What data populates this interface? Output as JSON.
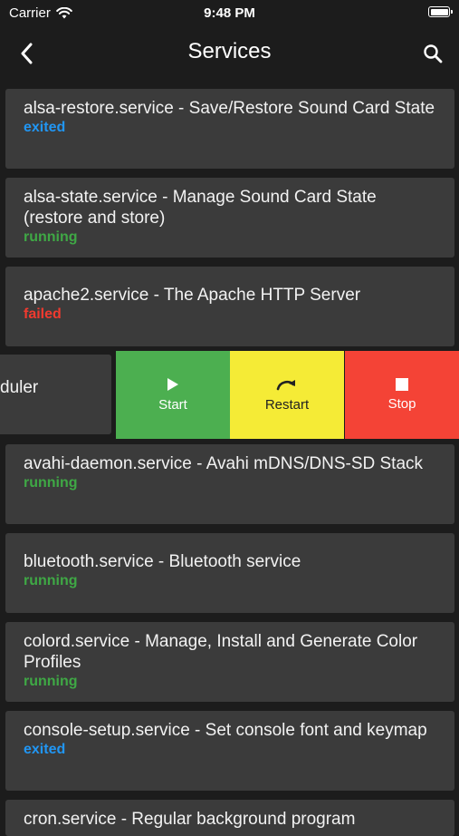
{
  "status_bar": {
    "carrier": "Carrier",
    "time": "9:48 PM"
  },
  "nav": {
    "title": "Services"
  },
  "services": [
    {
      "title": "alsa-restore.service - Save/Restore Sound Card State",
      "status": "exited"
    },
    {
      "title": "alsa-state.service - Manage Sound Card State (restore and store)",
      "status": "running"
    },
    {
      "title": "apache2.service - The Apache HTTP Server",
      "status": "failed"
    },
    {
      "title": "duler"
    },
    {
      "title": "avahi-daemon.service - Avahi mDNS/DNS-SD Stack",
      "status": "running"
    },
    {
      "title": "bluetooth.service - Bluetooth service",
      "status": "running"
    },
    {
      "title": "colord.service - Manage, Install and Generate Color Profiles",
      "status": "running"
    },
    {
      "title": "console-setup.service - Set console font and keymap",
      "status": "exited"
    },
    {
      "title": "cron.service - Regular background program"
    }
  ],
  "swipe_actions": {
    "start": "Start",
    "restart": "Restart",
    "stop": "Stop"
  },
  "colors": {
    "exited": "#2196f3",
    "running": "#3fa845",
    "failed": "#f03a2f",
    "start": "#4caf50",
    "restart": "#f5eb36",
    "stop": "#f44336"
  }
}
